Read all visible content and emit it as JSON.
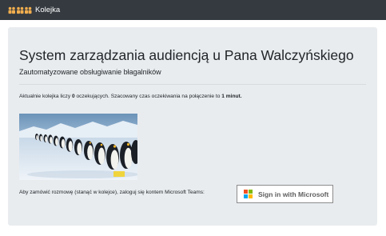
{
  "navbar": {
    "brand": "Kolejka",
    "icon": "people-group-icon",
    "icon_color": "#f0ad4e"
  },
  "main": {
    "title": "System zarządzania audiencją u Pana Walczyńskiego",
    "subtitle": "Zautomatyzowane obsługiwanie błagalników",
    "queue": {
      "prefix": "Aktualnie kolejka liczy ",
      "count": "0",
      "middle": " oczekujących. Szacowany czas oczekiwania na połączenie to ",
      "wait": "1 minut.",
      "suffix": ""
    },
    "image": {
      "icon": "penguins-photo"
    },
    "instruction": "Aby zamówić rozmowę (stanąć w kolejce), zaloguj się kontem Microsoft Teams:",
    "signin_button": {
      "label": "Sign in with Microsoft",
      "logo": "microsoft-logo-icon",
      "logo_colors": [
        "#f25022",
        "#7fba00",
        "#00a4ef",
        "#ffb900"
      ]
    }
  },
  "colors": {
    "navbar_bg": "#343a40",
    "jumbotron_bg": "#e9ecef",
    "text": "#212529"
  }
}
